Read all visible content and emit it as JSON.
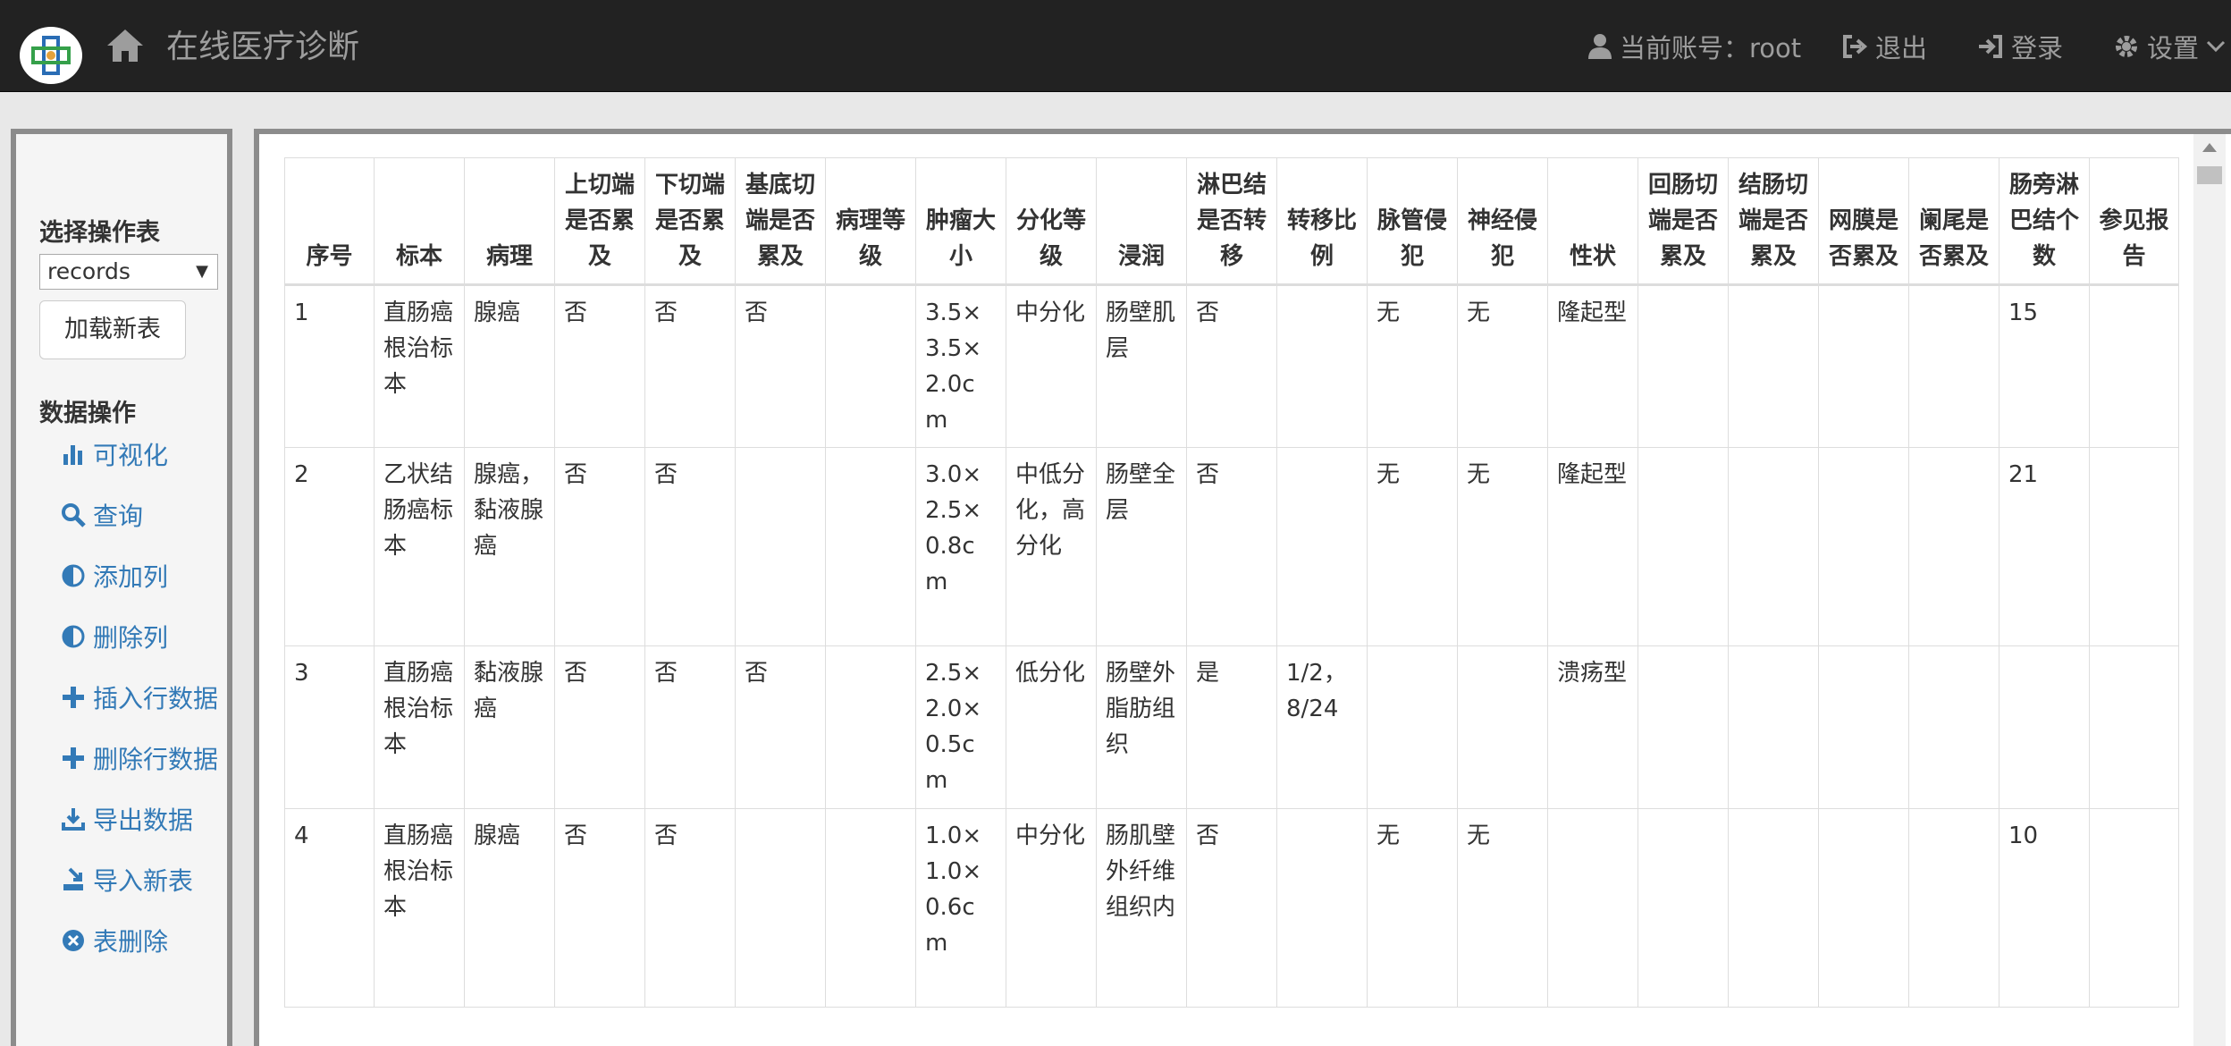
{
  "app": {
    "title": "在线医疗诊断"
  },
  "nav": {
    "account": "当前账号：root",
    "logout": "退出",
    "login": "登录",
    "settings": "设置"
  },
  "sidebar": {
    "select_table_title": "选择操作表",
    "selected_table": "records",
    "load_button": "加载新表",
    "ops_title": "数据操作",
    "ops": [
      {
        "label": "可视化",
        "icon": "bar-chart-icon"
      },
      {
        "label": "查询",
        "icon": "search-icon"
      },
      {
        "label": "添加列",
        "icon": "adjust-icon"
      },
      {
        "label": "删除列",
        "icon": "adjust-icon"
      },
      {
        "label": "插入行数据",
        "icon": "plus-icon"
      },
      {
        "label": "删除行数据",
        "icon": "plus-icon"
      },
      {
        "label": "导出数据",
        "icon": "download-icon"
      },
      {
        "label": "导入新表",
        "icon": "import-icon"
      },
      {
        "label": "表删除",
        "icon": "remove-circle-icon"
      }
    ]
  },
  "table": {
    "headers": [
      "序号",
      "标本",
      "病理",
      "上切端是否累及",
      "下切端是否累及",
      "基底切端是否累及",
      "病理等级",
      "肿瘤大小",
      "分化等级",
      "浸润",
      "淋巴结是否转移",
      "转移比例",
      "脉管侵犯",
      "神经侵犯",
      "性状",
      "回肠切端是否累及",
      "结肠切端是否累及",
      "网膜是否累及",
      "阑尾是否累及",
      "肠旁淋巴结个数",
      "参见报告"
    ],
    "rows": [
      [
        "1",
        "直肠癌根治标本",
        "腺癌",
        "否",
        "否",
        "否",
        "",
        "3.5×3.5×2.0cm",
        "中分化",
        "肠壁肌层",
        "否",
        "",
        "无",
        "无",
        "隆起型",
        "",
        "",
        "",
        "",
        "15",
        ""
      ],
      [
        "2",
        "乙状结肠癌标本",
        "腺癌，黏液腺癌",
        "否",
        "否",
        "",
        "",
        "3.0×2.5×0.8cm",
        "中低分化，高分化",
        "肠壁全层",
        "否",
        "",
        "无",
        "无",
        "隆起型",
        "",
        "",
        "",
        "",
        "21",
        ""
      ],
      [
        "3",
        "直肠癌根治标本",
        "黏液腺癌",
        "否",
        "否",
        "否",
        "",
        "2.5×2.0×0.5cm",
        "低分化",
        "肠壁外脂肪组织",
        "是",
        "1/2，8/24",
        "",
        "",
        "溃疡型",
        "",
        "",
        "",
        "",
        "",
        ""
      ],
      [
        "4",
        "直肠癌根治标本",
        "腺癌",
        "否",
        "否",
        "",
        "",
        "1.0×1.0×0.6cm",
        "中分化",
        "肠肌壁外纤维组织内",
        "否",
        "",
        "无",
        "无",
        "",
        "",
        "",
        "",
        "",
        "10",
        ""
      ]
    ]
  }
}
